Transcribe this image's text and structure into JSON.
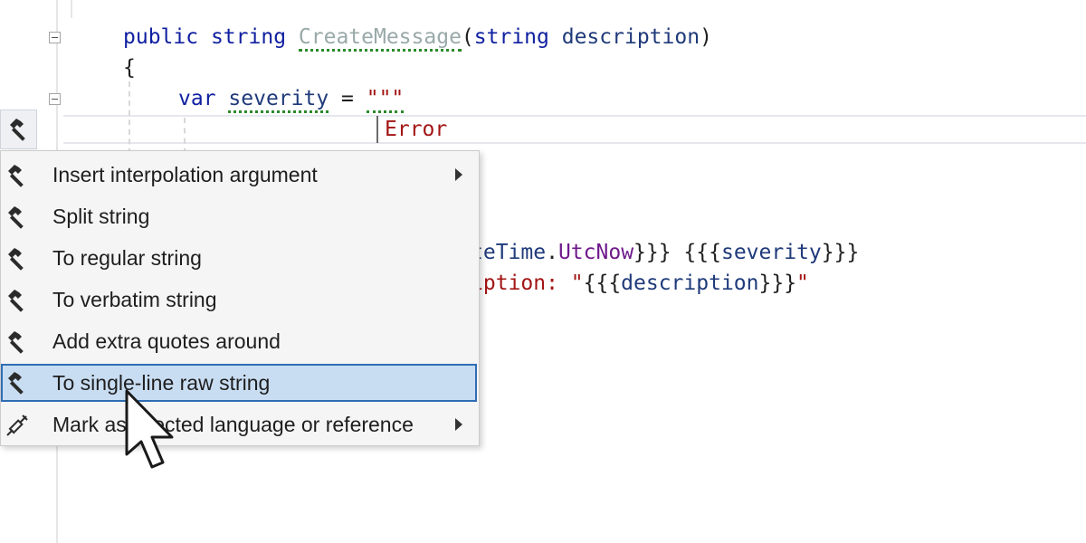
{
  "code": {
    "line1": {
      "kw_public": "public",
      "kw_string": "string",
      "method": "CreateMessage",
      "paren_open": "(",
      "param_type": "string",
      "param_name": "description",
      "paren_close": ")"
    },
    "line2": {
      "brace": "{"
    },
    "line3": {
      "kw_var": "var",
      "var_name": "severity",
      "equals": " = ",
      "quotes": "\"\"\""
    },
    "line4": {
      "text": "Error"
    },
    "line5": {
      "part1": "teTime",
      "dot": ".",
      "prop": "UtcNow",
      "part2": "}}} {{{",
      "var": "severity",
      "part3": "}}}"
    },
    "line6": {
      "str1": "iption: \"",
      "open": "{{{",
      "var": "description",
      "close": "}}}",
      "str2": "\""
    }
  },
  "menu": {
    "items": [
      {
        "label": "Insert interpolation argument",
        "submenu": true,
        "icon": "hammer-icon"
      },
      {
        "label": "Split string",
        "submenu": false,
        "icon": "hammer-icon"
      },
      {
        "label": "To regular string",
        "submenu": false,
        "icon": "hammer-icon"
      },
      {
        "label": "To verbatim string",
        "submenu": false,
        "icon": "hammer-icon"
      },
      {
        "label": "Add extra quotes around",
        "submenu": false,
        "icon": "hammer-icon"
      },
      {
        "label": "To single-line raw string",
        "submenu": false,
        "selected": true,
        "icon": "hammer-icon"
      },
      {
        "label": "Mark as injected language or reference",
        "submenu": true,
        "icon": "syringe-icon"
      }
    ]
  },
  "colors": {
    "keyword": "#0f1fa0",
    "identifier": "#1f3a7a",
    "string": "#a31515",
    "property": "#6f1a8c",
    "selection": "#c9ddf2",
    "selection_border": "#2f6db3"
  }
}
